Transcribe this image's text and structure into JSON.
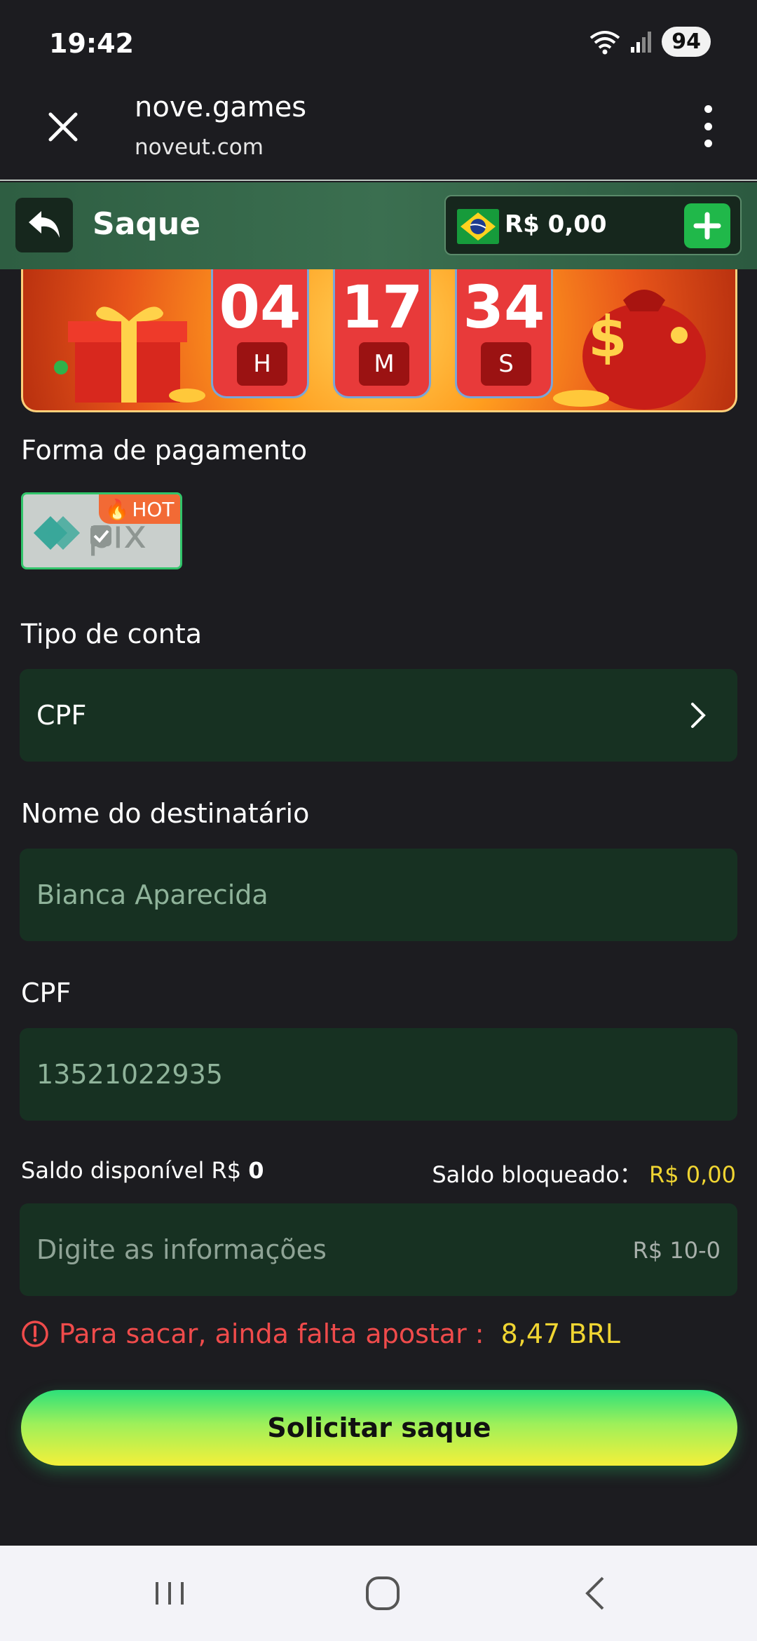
{
  "status_bar": {
    "time": "19:42",
    "battery": "94"
  },
  "browser": {
    "title": "nove.games",
    "url": "noveut.com"
  },
  "header": {
    "title": "Saque",
    "balance": "R$ 0,00"
  },
  "countdown": [
    {
      "value": "04",
      "unit": "H"
    },
    {
      "value": "17",
      "unit": "M"
    },
    {
      "value": "34",
      "unit": "S"
    }
  ],
  "payment": {
    "label": "Forma de pagamento",
    "method_text": "pix",
    "badge": "HOT"
  },
  "account_type": {
    "label": "Tipo de conta",
    "value": "CPF"
  },
  "recipient": {
    "label": "Nome do destinatário",
    "value": "Bianca Aparecida"
  },
  "cpf": {
    "label": "CPF",
    "value": "13521022935"
  },
  "saldo": {
    "available_label": "Saldo disponível R$",
    "available_value": "0",
    "blocked_label": "Saldo bloqueado：",
    "blocked_value": "R$ 0,00"
  },
  "amount": {
    "placeholder": "Digite as informações",
    "range": "R$ 10-0"
  },
  "warning": {
    "text": "Para sacar, ainda falta apostar :",
    "amount": "8,47 BRL"
  },
  "submit_label": "Solicitar saque",
  "colors": {
    "accent_green": "#20b84a",
    "field_bg": "#173122",
    "warning_red": "#ef4b4b",
    "amount_yellow": "#f0d532"
  }
}
